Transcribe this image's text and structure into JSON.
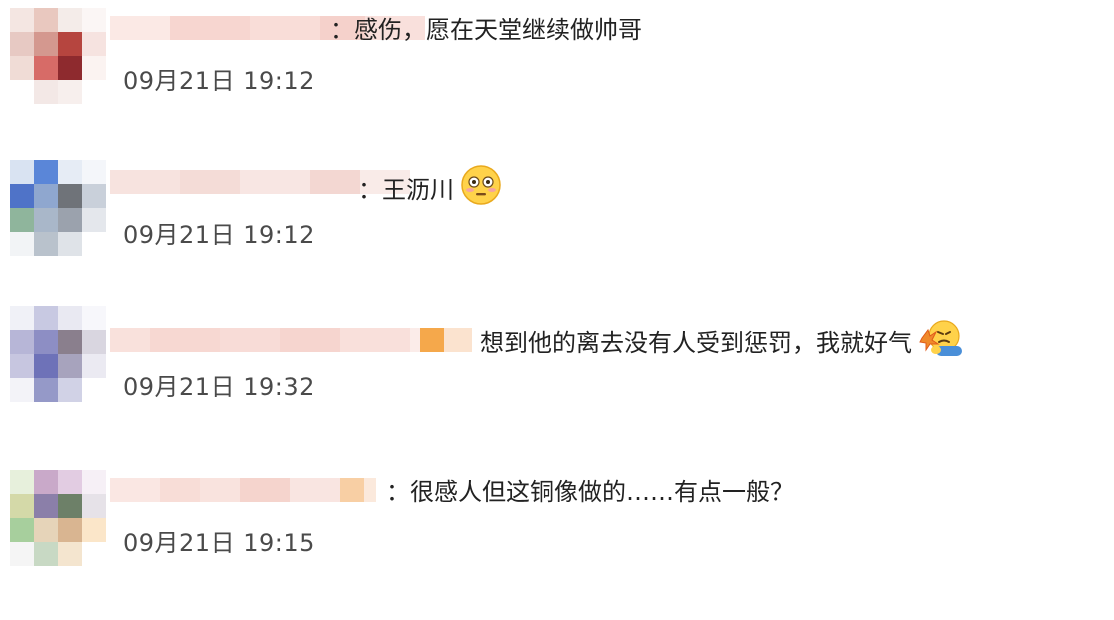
{
  "comments": [
    {
      "text": "：感伤，愿在天堂继续做帅哥",
      "time": "09月21日 19:12",
      "emoji": ""
    },
    {
      "text": "：王沥川",
      "time": "09月21日 19:12",
      "emoji": "flushed-face-emoji"
    },
    {
      "text": "想到他的离去没有人受到惩罚，我就好气",
      "time": "09月21日 19:32",
      "emoji": "angry-face-emoji"
    },
    {
      "text": "：很感人但这铜像做的……有点一般？",
      "time": "09月21日 19:15",
      "emoji": ""
    }
  ],
  "colors": {
    "text": "#222222",
    "time": "#4a4a4a",
    "background": "#ffffff"
  }
}
